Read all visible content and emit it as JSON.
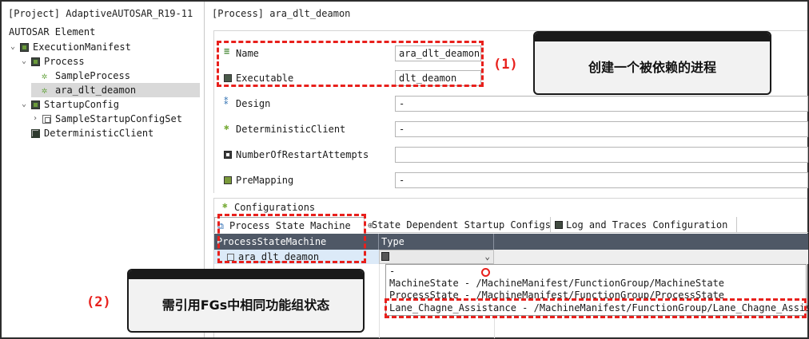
{
  "left_panel": {
    "title": "[Project] AdaptiveAUTOSAR_R19-11",
    "tree_root": "AUTOSAR Element",
    "tree": [
      {
        "label": "ExecutionManifest",
        "twisty": "⌄",
        "icon": "package-icon"
      },
      {
        "label": "Process",
        "twisty": "⌄",
        "icon": "package-icon"
      },
      {
        "label": "SampleProcess",
        "twisty": "",
        "icon": "process-icon"
      },
      {
        "label": "ara_dlt_deamon",
        "twisty": "",
        "icon": "process-icon"
      },
      {
        "label": "StartupConfig",
        "twisty": "⌄",
        "icon": "package-icon"
      },
      {
        "label": "SampleStartupConfigSet",
        "twisty": "›",
        "icon": "config-icon"
      },
      {
        "label": "DeterministicClient",
        "twisty": "",
        "icon": "grid-icon"
      }
    ]
  },
  "right_panel": {
    "title": "[Process] ara_dlt_deamon",
    "properties": [
      {
        "label": "Name",
        "value": "ara_dlt_deamon",
        "icon": "name-icon"
      },
      {
        "label": "Executable",
        "value": "dlt_deamon",
        "icon": "executable-icon"
      },
      {
        "label": "Design",
        "value": "-",
        "icon": "design-icon"
      },
      {
        "label": "DeterministicClient",
        "value": "-",
        "icon": "deterministic-icon"
      },
      {
        "label": "NumberOfRestartAttempts",
        "value": "",
        "icon": "number-icon"
      },
      {
        "label": "PreMapping",
        "value": "-",
        "icon": "premapping-icon"
      }
    ],
    "configurations": {
      "header": "Configurations",
      "tabs": [
        {
          "label": "Process State Machine",
          "icon": "psm-icon"
        },
        {
          "label": "State Dependent Startup Configs",
          "icon": "sdsc-icon"
        },
        {
          "label": "Log and Traces Configuration",
          "icon": "log-icon"
        }
      ],
      "columns": [
        "ProcessStateMachine",
        "Type"
      ],
      "row_name": "ara_dlt_deamon",
      "dropdown_options": [
        "-",
        "MachineState - /MachineManifest/FunctionGroup/MachineState",
        "ProcessState - /MachineManifest/FunctionGroup/ProcessState",
        "Lane_Chagne_Assistance - /MachineManifest/FunctionGroup/Lane_Chagne_Assistance"
      ]
    }
  },
  "annotations": {
    "label_1": "(1)",
    "label_2": "(2)",
    "callout_1": "创建一个被依赖的进程",
    "callout_2": "需引用FGs中相同功能组状态",
    "color": "#e8201c"
  }
}
